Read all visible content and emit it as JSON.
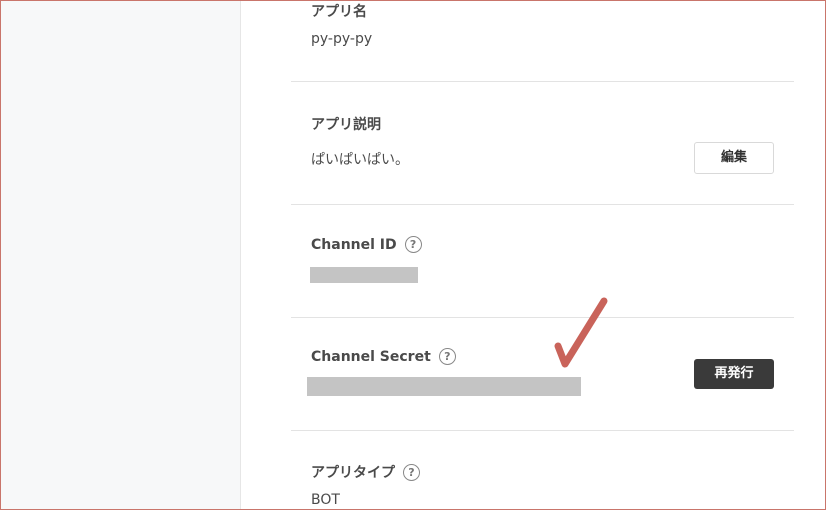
{
  "app_name": {
    "label": "アプリ名",
    "value": "py-py-py"
  },
  "app_description": {
    "label": "アプリ説明",
    "value": "ぱいぱいぱい。",
    "edit_label": "編集"
  },
  "channel_id": {
    "label": "Channel ID",
    "help": "?"
  },
  "channel_secret": {
    "label": "Channel Secret",
    "help": "?",
    "reissue_label": "再発行"
  },
  "app_type": {
    "label": "アプリタイプ",
    "help": "?",
    "value": "BOT"
  },
  "annotation": {
    "mark": "checkmark",
    "color": "#c9635a"
  },
  "colors": {
    "reissue_button": "#3a3a3a",
    "redaction": "#c4c4c4"
  }
}
